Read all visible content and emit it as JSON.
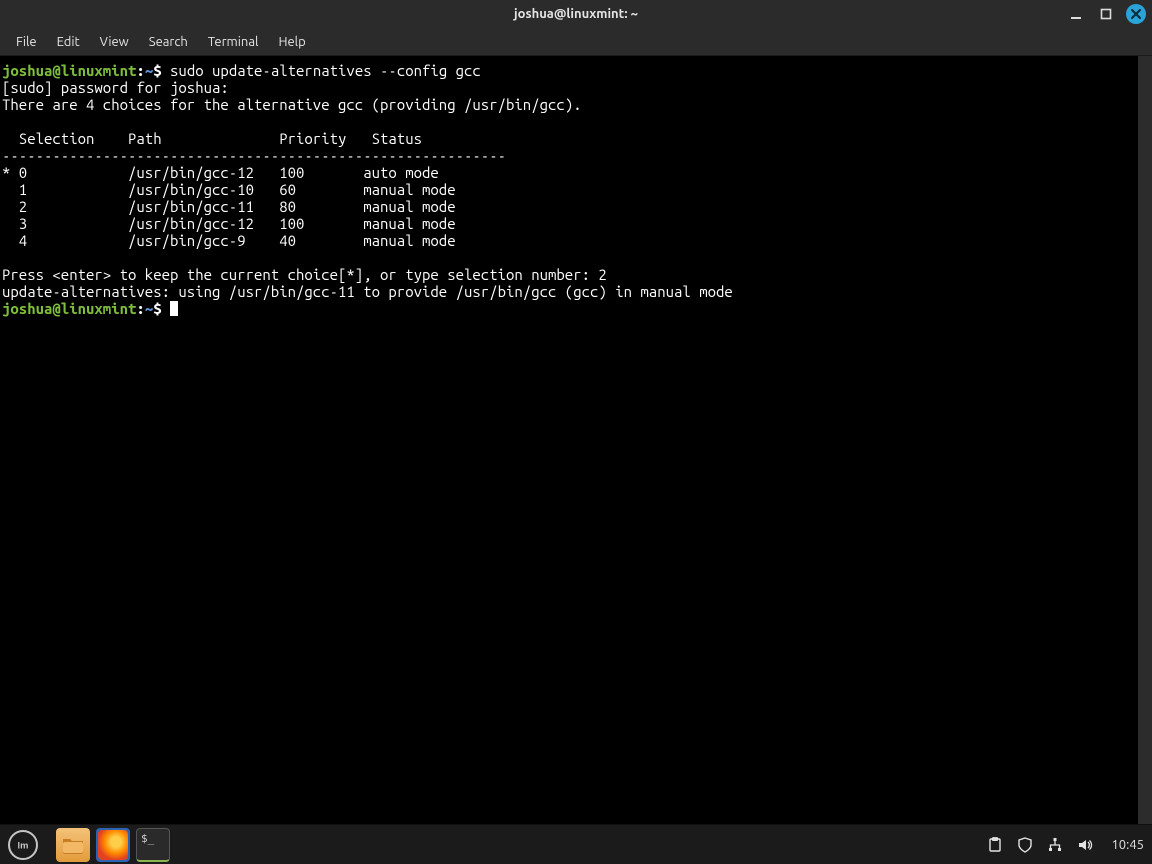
{
  "window": {
    "title": "joshua@linuxmint: ~"
  },
  "menubar": {
    "items": [
      "File",
      "Edit",
      "View",
      "Search",
      "Terminal",
      "Help"
    ]
  },
  "prompt": {
    "user_host": "joshua@linuxmint",
    "path": "~",
    "symbol": "$"
  },
  "terminal": {
    "cmd1": "sudo update-alternatives --config gcc",
    "line_sudo": "[sudo] password for joshua: ",
    "line_choices": "There are 4 choices for the alternative gcc (providing /usr/bin/gcc).",
    "header": "  Selection    Path              Priority   Status",
    "sep": "------------------------------------------------------------",
    "rows": [
      "* 0            /usr/bin/gcc-12   100       auto mode",
      "  1            /usr/bin/gcc-10   60        manual mode",
      "  2            /usr/bin/gcc-11   80        manual mode",
      "  3            /usr/bin/gcc-12   100       manual mode",
      "  4            /usr/bin/gcc-9    40        manual mode"
    ],
    "press_line": "Press <enter> to keep the current choice[*], or type selection number: 2",
    "result_line": "update-alternatives: using /usr/bin/gcc-11 to provide /usr/bin/gcc (gcc) in manual mode"
  },
  "taskbar": {
    "clock": "10:45"
  }
}
